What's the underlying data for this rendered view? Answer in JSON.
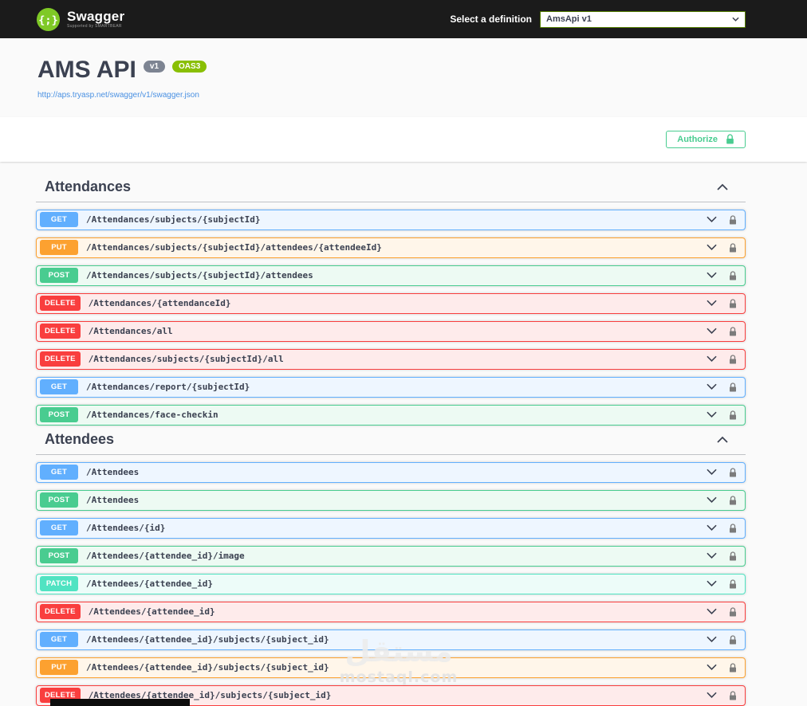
{
  "topbar": {
    "brand": "Swagger",
    "brand_sub": "Supported by SMARTBEAR",
    "select_label": "Select a definition",
    "select_value": "AmsApi v1"
  },
  "info": {
    "title": "AMS API",
    "version_badge": "v1",
    "oas_badge": "OAS3",
    "spec_url": "http://aps.tryasp.net/swagger/v1/swagger.json"
  },
  "auth": {
    "authorize_label": "Authorize"
  },
  "sections": [
    {
      "title": "Attendances",
      "operations": [
        {
          "method": "GET",
          "path": "/Attendances/subjects/{subjectId}"
        },
        {
          "method": "PUT",
          "path": "/Attendances/subjects/{subjectId}/attendees/{attendeeId}"
        },
        {
          "method": "POST",
          "path": "/Attendances/subjects/{subjectId}/attendees"
        },
        {
          "method": "DELETE",
          "path": "/Attendances/{attendanceId}"
        },
        {
          "method": "DELETE",
          "path": "/Attendances/all"
        },
        {
          "method": "DELETE",
          "path": "/Attendances/subjects/{subjectId}/all"
        },
        {
          "method": "GET",
          "path": "/Attendances/report/{subjectId}"
        },
        {
          "method": "POST",
          "path": "/Attendances/face-checkin"
        }
      ]
    },
    {
      "title": "Attendees",
      "operations": [
        {
          "method": "GET",
          "path": "/Attendees"
        },
        {
          "method": "POST",
          "path": "/Attendees"
        },
        {
          "method": "GET",
          "path": "/Attendees/{id}"
        },
        {
          "method": "POST",
          "path": "/Attendees/{attendee_id}/image"
        },
        {
          "method": "PATCH",
          "path": "/Attendees/{attendee_id}"
        },
        {
          "method": "DELETE",
          "path": "/Attendees/{attendee_id}"
        },
        {
          "method": "GET",
          "path": "/Attendees/{attendee_id}/subjects/{subject_id}"
        },
        {
          "method": "PUT",
          "path": "/Attendees/{attendee_id}/subjects/{subject_id}"
        },
        {
          "method": "DELETE",
          "path": "/Attendees/{attendee_id}/subjects/{subject_id}"
        }
      ]
    }
  ],
  "method_styles": {
    "GET": {
      "badge": "#61affe",
      "border": "#61affe",
      "bg": "#eef6ff"
    },
    "POST": {
      "badge": "#49cc90",
      "border": "#49cc90",
      "bg": "#edfaf3"
    },
    "PUT": {
      "badge": "#fca130",
      "border": "#fca130",
      "bg": "#fff6ea"
    },
    "DELETE": {
      "badge": "#f93e3e",
      "border": "#f93e3e",
      "bg": "#feebeb"
    },
    "PATCH": {
      "badge": "#50e3c2",
      "border": "#50e3c2",
      "bg": "#edfcf9"
    }
  },
  "colors": {
    "topbar_bg": "#1b1b1b",
    "accent_green": "#49cc90",
    "link_blue": "#4990e2",
    "text_dark": "#3b4151"
  },
  "watermark": {
    "line1": "مستقل",
    "line2": "mostaql.com"
  }
}
